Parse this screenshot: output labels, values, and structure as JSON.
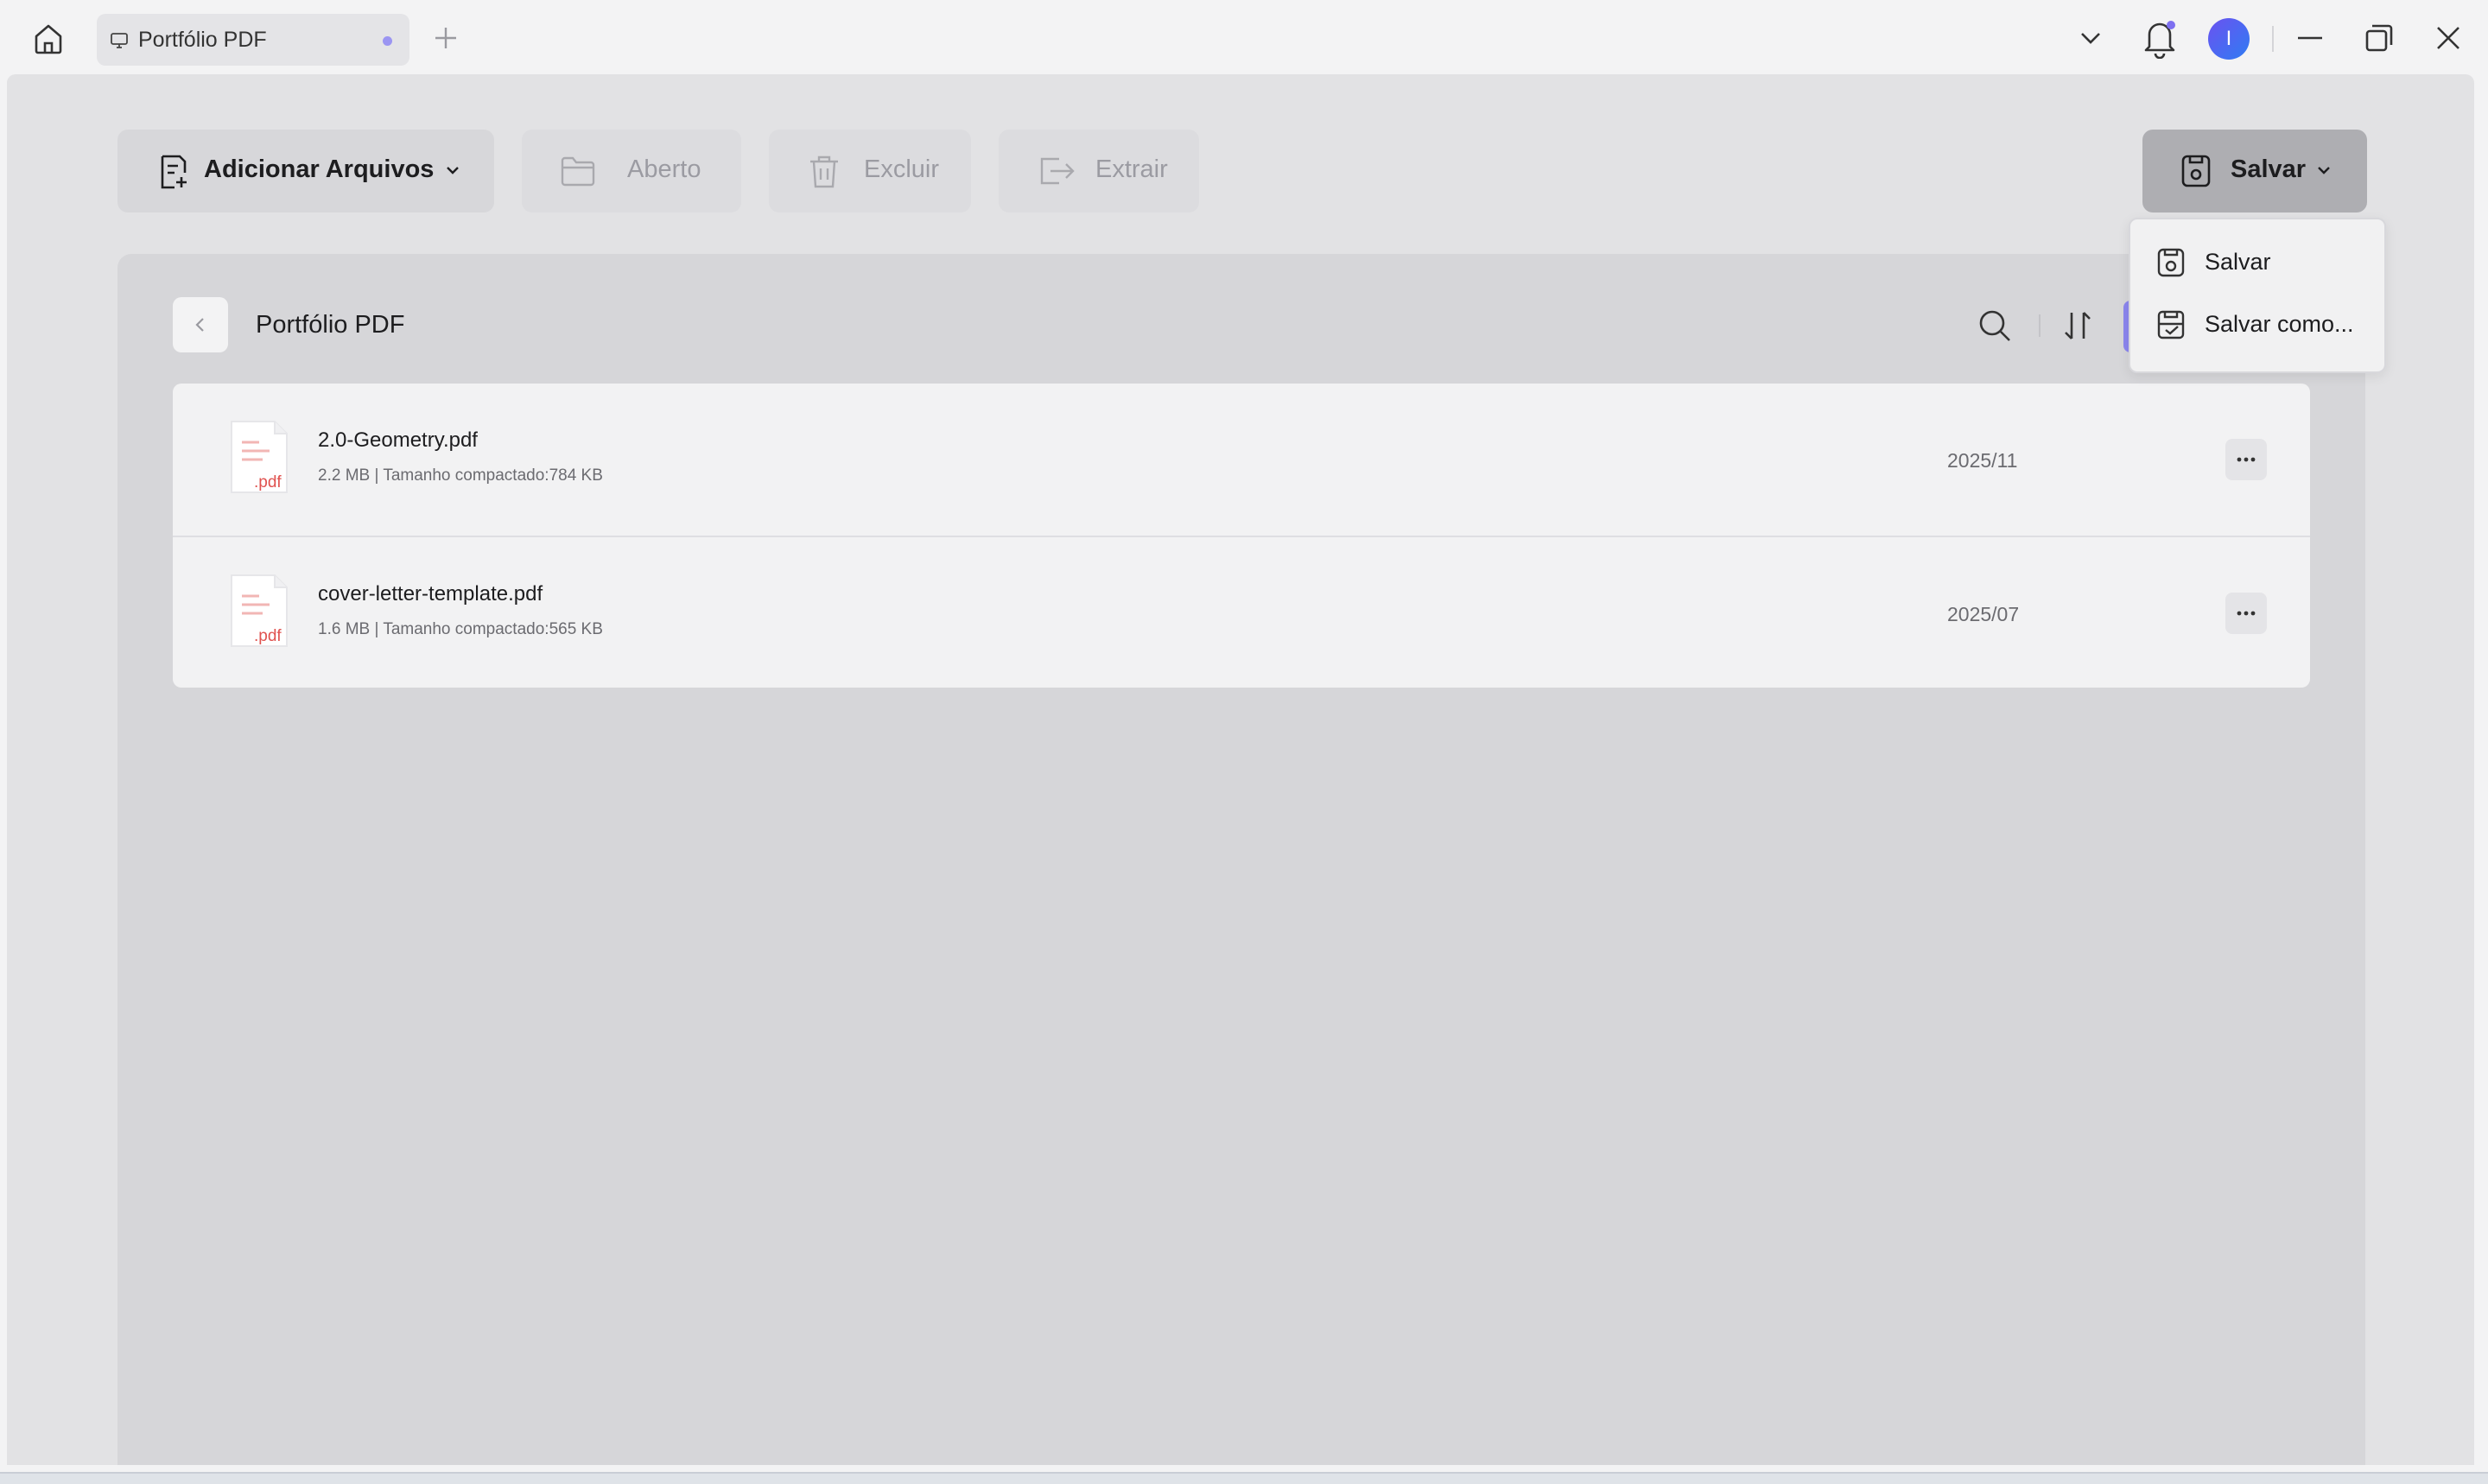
{
  "titlebar": {
    "tab_label": "Portfólio PDF",
    "avatar_initial": "I"
  },
  "toolbar": {
    "add_files_label": "Adicionar Arquivos",
    "open_label": "Aberto",
    "delete_label": "Excluir",
    "extract_label": "Extrair",
    "save_label": "Salvar"
  },
  "content": {
    "title": "Portfólio PDF",
    "files": [
      {
        "name": "2.0-Geometry.pdf",
        "meta": "2.2 MB | Tamanho compactado:784 KB",
        "date": "2025/11",
        "ext": ".pdf"
      },
      {
        "name": "cover-letter-template.pdf",
        "meta": "1.6 MB | Tamanho compactado:565 KB",
        "date": "2025/07",
        "ext": ".pdf"
      }
    ]
  },
  "save_menu": {
    "items": [
      {
        "label": "Salvar",
        "icon": "save-icon"
      },
      {
        "label": "Salvar como...",
        "icon": "save-as-icon"
      }
    ]
  },
  "colors": {
    "accent": "#8b86ee",
    "avatar_gradient_start": "#6b52f0",
    "avatar_gradient_end": "#2f7cf3",
    "pdf_red": "#e0524f"
  }
}
